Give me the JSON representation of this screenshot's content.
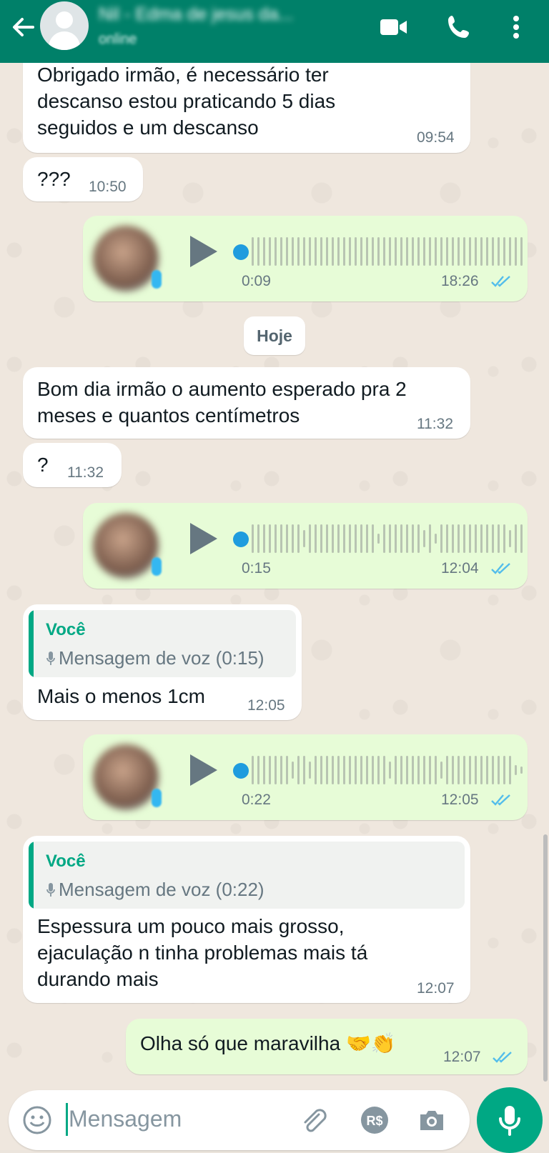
{
  "header": {
    "contact_name": "Nil - Edma de jesus da...",
    "status": "online"
  },
  "colors": {
    "header_bg": "#008069",
    "incoming_bubble": "#ffffff",
    "outgoing_bubble": "#e7fcd7",
    "accent": "#00a884",
    "voice_dot": "#1f9cde"
  },
  "messages": {
    "m1": {
      "lines": [
        "Obrigado irmão, é necessário ter",
        "descanso estou praticando 5 dias",
        "seguidos e um descanso"
      ],
      "time": "09:54"
    },
    "m2": {
      "text": "???",
      "time": "10:50"
    },
    "v1": {
      "duration": "0:09",
      "time": "18:26"
    },
    "date_separator": "Hoje",
    "m3": {
      "lines": [
        "Bom dia irmão o aumento esperado pra 2",
        "meses e quantos centímetros"
      ],
      "time": "11:32"
    },
    "m4": {
      "text": "?",
      "time": "11:32"
    },
    "v2": {
      "duration": "0:15",
      "time": "12:04"
    },
    "m5": {
      "quote_author": "Você",
      "quote_text": "Mensagem de voz (0:15)",
      "text": "Mais o menos 1cm",
      "time": "12:05"
    },
    "v3": {
      "duration": "0:22",
      "time": "12:05"
    },
    "m6": {
      "quote_author": "Você",
      "quote_text": "Mensagem de voz (0:22)",
      "lines": [
        "Espessura um pouco mais grosso,",
        "ejaculação n tinha problemas mais tá",
        "durando mais"
      ],
      "time": "12:07"
    },
    "m7": {
      "text": "Olha só que maravilha",
      "emoji": "🤝👏",
      "time": "12:07"
    }
  },
  "input": {
    "placeholder": "Mensagem"
  },
  "icons": [
    "back-arrow-icon",
    "video-call-icon",
    "phone-icon",
    "more-vert-icon",
    "emoji-icon",
    "attach-icon",
    "pix-icon",
    "camera-icon",
    "mic-icon",
    "play-icon",
    "double-check-icon"
  ]
}
